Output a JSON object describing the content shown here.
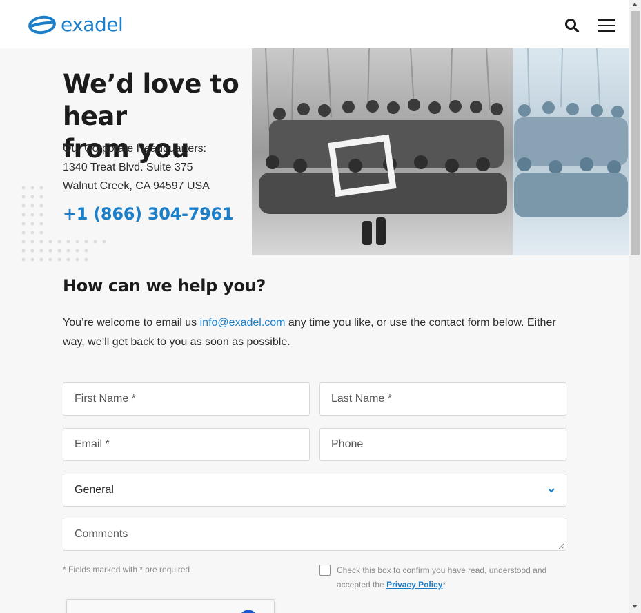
{
  "header": {
    "logo_text": "exadel",
    "search_icon": "search-icon",
    "menu_icon": "hamburger-menu-icon"
  },
  "hero": {
    "title_line1": "We’d love to hear",
    "title_line2": "from you",
    "hq_label": "Our Corporate Headquarters:",
    "hq_address1": "1340 Treat Blvd. Suite 375",
    "hq_address2": "Walnut Creek, CA 94597 USA",
    "phone": "+1 (866) 304-7961"
  },
  "help": {
    "title": "How can we help you?",
    "text_before": "You’re welcome to email us ",
    "email": "info@exadel.com",
    "text_after": " any time you like, or use the contact form below. Either way, we’ll get back to you as soon as possible."
  },
  "form": {
    "first_name_placeholder": "First Name *",
    "last_name_placeholder": "Last Name *",
    "email_placeholder": "Email *",
    "phone_placeholder": "Phone",
    "topic_selected": "General",
    "comments_placeholder": "Comments",
    "required_note": "* Fields marked with * are required",
    "consent_text": "Check this box to confirm you have read, understood and accepted the ",
    "privacy_link": "Privacy Policy",
    "consent_suffix": "*"
  },
  "colors": {
    "brand_blue": "#1c7fc9",
    "heading": "#1b1b1b",
    "page_bg": "#f7f7f7"
  }
}
